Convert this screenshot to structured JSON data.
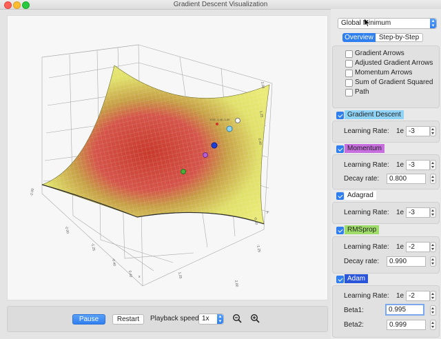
{
  "window": {
    "title": "Gradient Descent Visualization"
  },
  "plot": {
    "ticks": [
      "-2.00",
      "-1.25",
      "-0.40",
      "0.40",
      "1.25",
      "2.00",
      "-2.00",
      "-1.25",
      "-0.40",
      "0.40",
      "1.25",
      "2.00"
    ],
    "axis_labels": [
      "x",
      "y"
    ],
    "point_tooltip": "0.00 -1.40 -1.40",
    "colors": {
      "surface_low": "#c83a2c",
      "surface_mid": "#c7a047",
      "surface_high": "#e0e06b"
    },
    "optimizer_colors": {
      "gradient_descent": "#2f7fa8",
      "momentum": "#b75fd3",
      "adagrad": "#ffffff",
      "rmsprop": "#4caf3a",
      "adam": "#1b3fd6"
    }
  },
  "controls": {
    "pause_label": "Pause",
    "restart_label": "Restart",
    "playback_speed_label": "Playback speed:",
    "playback_speed_value": "1x",
    "zoom_out_icon": "zoom-out-icon",
    "zoom_in_icon": "zoom-in-icon"
  },
  "sidebar": {
    "surface_select": "Global Minimum",
    "tabs": [
      {
        "label": "Overview",
        "selected": true
      },
      {
        "label": "Step-by-Step",
        "selected": false
      }
    ],
    "visualization_options": [
      {
        "label": "Gradient Arrows",
        "checked": false
      },
      {
        "label": "Adjusted Gradient Arrows",
        "checked": false
      },
      {
        "label": "Momentum Arrows",
        "checked": false
      },
      {
        "label": "Sum of Gradient Squared",
        "checked": false
      },
      {
        "label": "Path",
        "checked": false
      }
    ],
    "optimizers": {
      "gradient_descent": {
        "name": "Gradient Descent",
        "checked": true,
        "header_color": "#8fd3f7",
        "learning_rate_label": "Learning Rate:",
        "learning_rate_prefix": "1e",
        "learning_rate_exp": "-3"
      },
      "momentum": {
        "name": "Momentum",
        "checked": true,
        "header_color": "#c86fe0",
        "learning_rate_label": "Learning Rate:",
        "learning_rate_prefix": "1e",
        "learning_rate_exp": "-3",
        "decay_label": "Decay rate:",
        "decay_value": "0.800"
      },
      "adagrad": {
        "name": "Adagrad",
        "checked": true,
        "header_color": "#ffffff",
        "learning_rate_label": "Learning Rate:",
        "learning_rate_prefix": "1e",
        "learning_rate_exp": "-3"
      },
      "rmsprop": {
        "name": "RMSprop",
        "checked": true,
        "header_color": "#9fdc6a",
        "learning_rate_label": "Learning Rate:",
        "learning_rate_prefix": "1e",
        "learning_rate_exp": "-2",
        "decay_label": "Decay rate:",
        "decay_value": "0.990"
      },
      "adam": {
        "name": "Adam",
        "checked": true,
        "header_color": "#2a55d8",
        "learning_rate_label": "Learning Rate:",
        "learning_rate_prefix": "1e",
        "learning_rate_exp": "-2",
        "beta1_label": "Beta1:",
        "beta1_value": "0.995",
        "beta2_label": "Beta2:",
        "beta2_value": "0.999"
      }
    }
  }
}
